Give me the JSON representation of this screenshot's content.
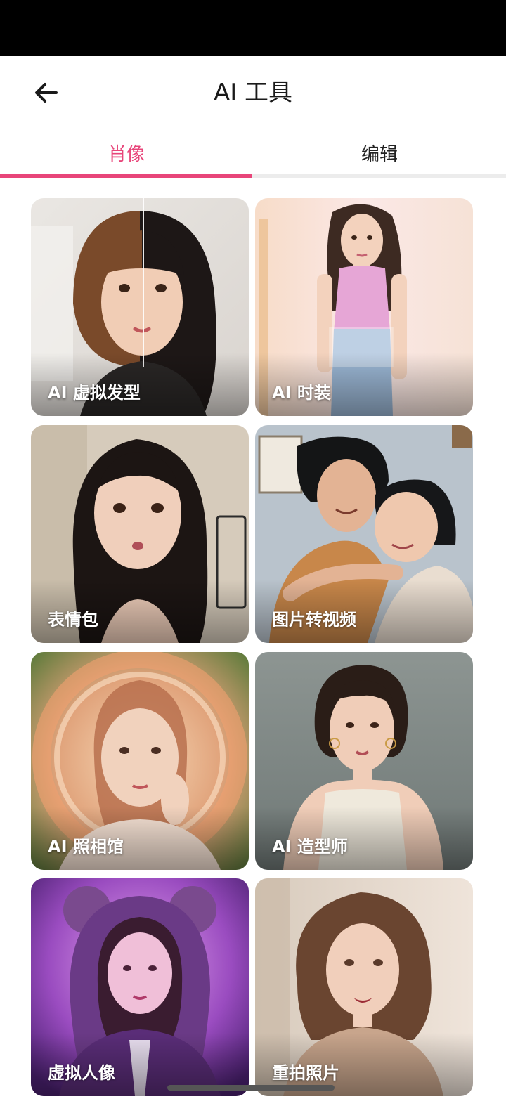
{
  "header": {
    "title": "AI 工具",
    "back_icon": "arrow-left-icon"
  },
  "tabs": [
    {
      "label": "肖像",
      "active": true
    },
    {
      "label": "编辑",
      "active": false
    }
  ],
  "colors": {
    "accent": "#e8457a",
    "status_bar": "#000000",
    "background": "#ffffff"
  },
  "tools": [
    {
      "label": "AI 虚拟发型"
    },
    {
      "label": "AI 时装"
    },
    {
      "label": "表情包"
    },
    {
      "label": "图片转视频"
    },
    {
      "label": "AI 照相馆"
    },
    {
      "label": "AI 造型师"
    },
    {
      "label": "虚拟人像"
    },
    {
      "label": "重拍照片"
    }
  ]
}
